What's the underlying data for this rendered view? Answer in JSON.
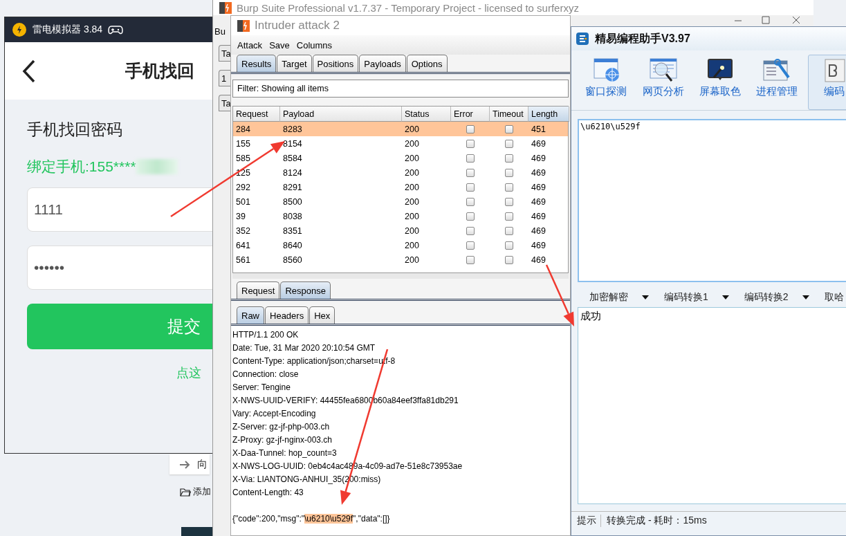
{
  "background_page": {
    "button": "向",
    "link": "添加"
  },
  "emulator": {
    "title": "雷电模拟器 3.84",
    "page_title": "手机找回",
    "heading": "手机找回密码",
    "bound_phone": "绑定手机:155****",
    "code_field": {
      "value": "1111"
    },
    "password_field": {
      "value": "••••••"
    },
    "submit_button": "提交",
    "link": "点这"
  },
  "burp_main": {
    "title": "Burp Suite Professional v1.7.37 - Temporary Project - licensed to surferxyz",
    "menu": [
      "Bu"
    ],
    "tabs": [
      "Ta",
      "1",
      "Ta"
    ]
  },
  "intruder": {
    "title": "Intruder attack 2",
    "menu": [
      "Attack",
      "Save",
      "Columns"
    ],
    "tabs": [
      {
        "label": "Results",
        "selected": true
      },
      {
        "label": "Target",
        "selected": false
      },
      {
        "label": "Positions",
        "selected": false
      },
      {
        "label": "Payloads",
        "selected": false
      },
      {
        "label": "Options",
        "selected": false
      }
    ],
    "filter": "Filter: Showing all items",
    "table": {
      "columns": [
        {
          "label": "Request",
          "sorted": false
        },
        {
          "label": "Payload",
          "sorted": false
        },
        {
          "label": "Status",
          "sorted": false
        },
        {
          "label": "Error",
          "sorted": false
        },
        {
          "label": "Timeout",
          "sorted": false
        },
        {
          "label": "Length",
          "sorted": true
        }
      ],
      "rows": [
        {
          "request": "284",
          "payload": "8283",
          "status": "200",
          "error": false,
          "timeout": false,
          "length": "451",
          "selected": true
        },
        {
          "request": "155",
          "payload": "8154",
          "status": "200",
          "error": false,
          "timeout": false,
          "length": "469",
          "selected": false
        },
        {
          "request": "585",
          "payload": "8584",
          "status": "200",
          "error": false,
          "timeout": false,
          "length": "469",
          "selected": false
        },
        {
          "request": "125",
          "payload": "8124",
          "status": "200",
          "error": false,
          "timeout": false,
          "length": "469",
          "selected": false
        },
        {
          "request": "292",
          "payload": "8291",
          "status": "200",
          "error": false,
          "timeout": false,
          "length": "469",
          "selected": false
        },
        {
          "request": "501",
          "payload": "8500",
          "status": "200",
          "error": false,
          "timeout": false,
          "length": "469",
          "selected": false
        },
        {
          "request": "39",
          "payload": "8038",
          "status": "200",
          "error": false,
          "timeout": false,
          "length": "469",
          "selected": false
        },
        {
          "request": "352",
          "payload": "8351",
          "status": "200",
          "error": false,
          "timeout": false,
          "length": "469",
          "selected": false
        },
        {
          "request": "641",
          "payload": "8640",
          "status": "200",
          "error": false,
          "timeout": false,
          "length": "469",
          "selected": false
        },
        {
          "request": "561",
          "payload": "8560",
          "status": "200",
          "error": false,
          "timeout": false,
          "length": "469",
          "selected": false
        }
      ]
    },
    "message_tabs": [
      {
        "label": "Request",
        "selected": false
      },
      {
        "label": "Response",
        "selected": true
      }
    ],
    "view_tabs": [
      {
        "label": "Raw",
        "selected": true
      },
      {
        "label": "Headers",
        "selected": false
      },
      {
        "label": "Hex",
        "selected": false
      }
    ],
    "response_lines": [
      "HTTP/1.1 200 OK",
      "Date: Tue, 31 Mar 2020 20:10:54 GMT",
      "Content-Type: application/json;charset=utf-8",
      "Connection: close",
      "Server: Tengine",
      "X-NWS-UUID-VERIFY: 44455fea6800b60a84eef3ffa81db291",
      "Vary: Accept-Encoding",
      "Z-Server: gz-jf-php-003.ch",
      "Z-Proxy: gz-jf-nginx-003.ch",
      "X-Daa-Tunnel: hop_count=3",
      "X-NWS-LOG-UUID: 0eb4c4ac489a-4c09-ad7e-51e8c73953ae",
      "X-Via: LIANTONG-ANHUI_35(200:miss)",
      "Content-Length: 43"
    ],
    "response_body": [
      {
        "text": "{\"code\":200,\"msg\":\"",
        "highlighted": false
      },
      {
        "text": "\\u6210\\u529f",
        "highlighted": true
      },
      {
        "text": "\",\"data\":[]}",
        "highlighted": false
      }
    ]
  },
  "helper": {
    "title": "精易编程助手V3.97",
    "tools": [
      {
        "label": "窗口探测",
        "selected": false
      },
      {
        "label": "网页分析",
        "selected": false
      },
      {
        "label": "屏幕取色",
        "selected": false
      },
      {
        "label": "进程管理",
        "selected": false
      },
      {
        "label": "编码",
        "selected": true
      }
    ],
    "input": {
      "value": "\\u6210\\u529f"
    },
    "menus": [
      {
        "label": "加密解密",
        "dropdown": true
      },
      {
        "label": "编码转换1",
        "dropdown": true
      },
      {
        "label": "编码转换2",
        "dropdown": true
      },
      {
        "label": "取哈",
        "dropdown": false
      }
    ],
    "output": {
      "value": "成功"
    },
    "status_bar": {
      "label": "提示",
      "message": "转换完成 - 耗时：15ms"
    }
  }
}
